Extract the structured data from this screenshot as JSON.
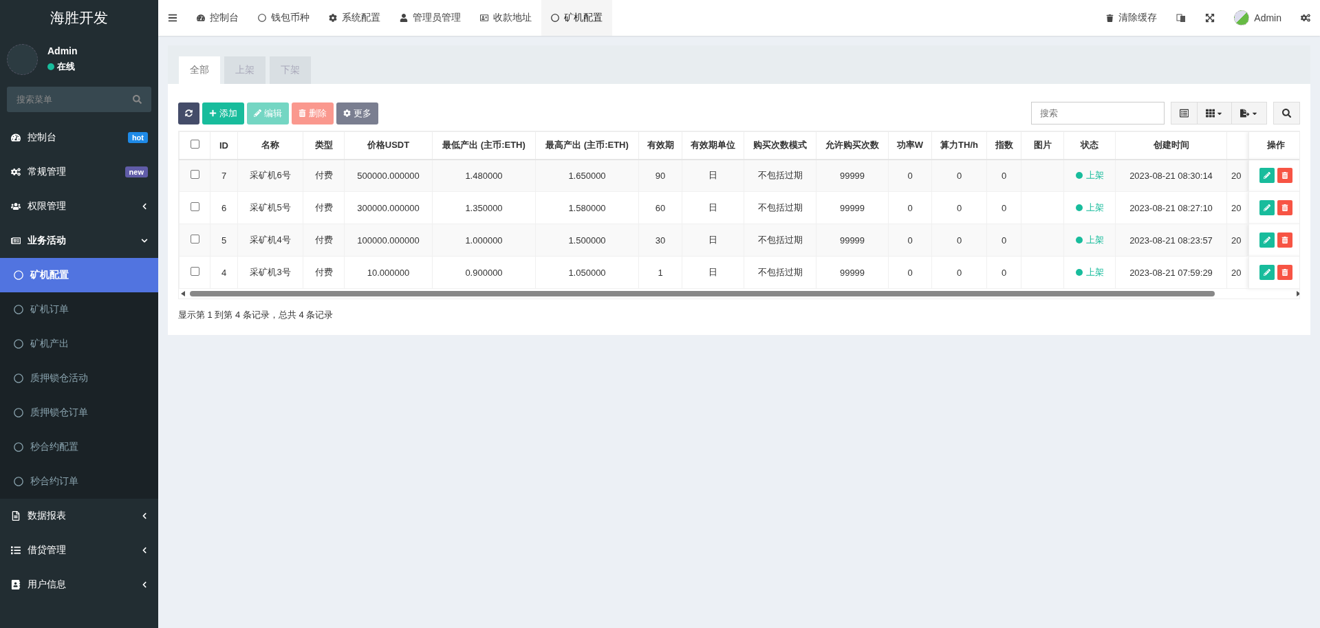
{
  "sidebar": {
    "logo": "海胜开发",
    "user": {
      "name": "Admin",
      "status": "在线"
    },
    "search": {
      "placeholder": "搜索菜单"
    },
    "items": [
      {
        "label": "控制台",
        "badge": {
          "text": "hot",
          "color": "#1e8ae7"
        }
      },
      {
        "label": "常规管理",
        "badge": {
          "text": "new",
          "color": "#605ca8"
        }
      },
      {
        "label": "权限管理",
        "expanded": false
      },
      {
        "label": "业务活动",
        "expanded": true,
        "children": [
          {
            "label": "矿机配置",
            "selected": true
          },
          {
            "label": "矿机订单",
            "selected": false
          },
          {
            "label": "矿机产出",
            "selected": false
          },
          {
            "label": "质押锁仓活动",
            "selected": false
          },
          {
            "label": "质押锁仓订单",
            "selected": false
          },
          {
            "label": "秒合约配置",
            "selected": false
          },
          {
            "label": "秒合约订单",
            "selected": false
          }
        ]
      },
      {
        "label": "数据报表",
        "expanded": false
      },
      {
        "label": "借贷管理",
        "expanded": false
      },
      {
        "label": "用户信息",
        "expanded": false
      }
    ]
  },
  "header": {
    "nav": [
      {
        "label": "控制台",
        "selected": false
      },
      {
        "label": "钱包币种",
        "selected": false
      },
      {
        "label": "系统配置",
        "selected": false
      },
      {
        "label": "管理员管理",
        "selected": false
      },
      {
        "label": "收款地址",
        "selected": false
      },
      {
        "label": "矿机配置",
        "selected": true
      }
    ],
    "clear_cache": "清除缓存",
    "user": "Admin"
  },
  "tabs": [
    {
      "label": "全部",
      "selected": true
    },
    {
      "label": "上架",
      "selected": false
    },
    {
      "label": "下架",
      "selected": false
    }
  ],
  "toolbar": {
    "buttons": [
      {
        "kind": "refresh",
        "disabled": false
      },
      {
        "kind": "add",
        "label": "添加",
        "disabled": false
      },
      {
        "kind": "edit",
        "label": "编辑",
        "disabled": true
      },
      {
        "kind": "delete",
        "label": "删除",
        "disabled": true
      },
      {
        "kind": "more",
        "label": "更多",
        "disabled": false
      }
    ],
    "search": {
      "placeholder": "搜索"
    }
  },
  "table": {
    "header_checked": false,
    "columns": [
      "ID",
      "名称",
      "类型",
      "价格USDT",
      "最低产出 (主币:ETH)",
      "最高产出 (主币:ETH)",
      "有效期",
      "有效期单位",
      "购买次数模式",
      "允许购买次数",
      "功率W",
      "算力TH/h",
      "指数",
      "图片",
      "状态",
      "创建时间",
      "",
      "操作"
    ],
    "rows": [
      {
        "checked": false,
        "cells": [
          "7",
          "采矿机6号",
          "付费",
          "500000.000000",
          "1.480000",
          "1.650000",
          "90",
          "日",
          "不包括过期",
          "99999",
          "0",
          "0",
          "0"
        ],
        "status": {
          "text": "上架",
          "color": "#18bc9c"
        },
        "created": "2023-08-21 08:30:14",
        "column_18": "20"
      },
      {
        "checked": false,
        "cells": [
          "6",
          "采矿机5号",
          "付费",
          "300000.000000",
          "1.350000",
          "1.580000",
          "60",
          "日",
          "不包括过期",
          "99999",
          "0",
          "0",
          "0"
        ],
        "status": {
          "text": "上架",
          "color": "#18bc9c"
        },
        "created": "2023-08-21 08:27:10",
        "column_18": "20"
      },
      {
        "checked": false,
        "cells": [
          "5",
          "采矿机4号",
          "付费",
          "100000.000000",
          "1.000000",
          "1.500000",
          "30",
          "日",
          "不包括过期",
          "99999",
          "0",
          "0",
          "0"
        ],
        "status": {
          "text": "上架",
          "color": "#18bc9c"
        },
        "created": "2023-08-21 08:23:57",
        "column_18": "20"
      },
      {
        "checked": false,
        "cells": [
          "4",
          "采矿机3号",
          "付费",
          "10.000000",
          "0.900000",
          "1.050000",
          "1",
          "日",
          "不包括过期",
          "99999",
          "0",
          "0",
          "0"
        ],
        "status": {
          "text": "上架",
          "color": "#18bc9c"
        },
        "created": "2023-08-21 07:59:29",
        "column_18": "20"
      }
    ]
  },
  "pagination": "显示第 1 到第 4 条记录，总共 4 条记录"
}
